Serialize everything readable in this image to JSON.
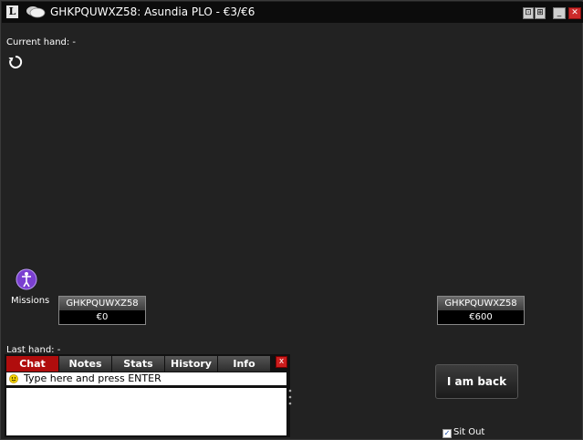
{
  "window": {
    "app_logo": "L",
    "title": "GHKPQUWXZ58: Asundia PLO - €3/€6",
    "buttons": {
      "restore": "⊡",
      "tile": "⊞",
      "minimize": "_",
      "close": "✕"
    }
  },
  "table": {
    "current_hand_label": "Current hand: -",
    "last_hand_label": "Last hand: -",
    "missions_label": "Missions",
    "seats": [
      {
        "name": "GHKPQUWXZ58",
        "stack": "€0"
      },
      {
        "name": "GHKPQUWXZ58",
        "stack": "€600"
      }
    ]
  },
  "chat_panel": {
    "tabs": [
      "Chat",
      "Notes",
      "Stats",
      "History",
      "Info"
    ],
    "active_tab": "Chat",
    "close_label": "x",
    "input_placeholder": "Type here and press ENTER"
  },
  "actions": {
    "back_button": "I am back",
    "sit_out_label": "Sit Out",
    "sit_out_checked": true
  },
  "colors": {
    "background": "#222222",
    "accent_red": "#b00d0d"
  }
}
